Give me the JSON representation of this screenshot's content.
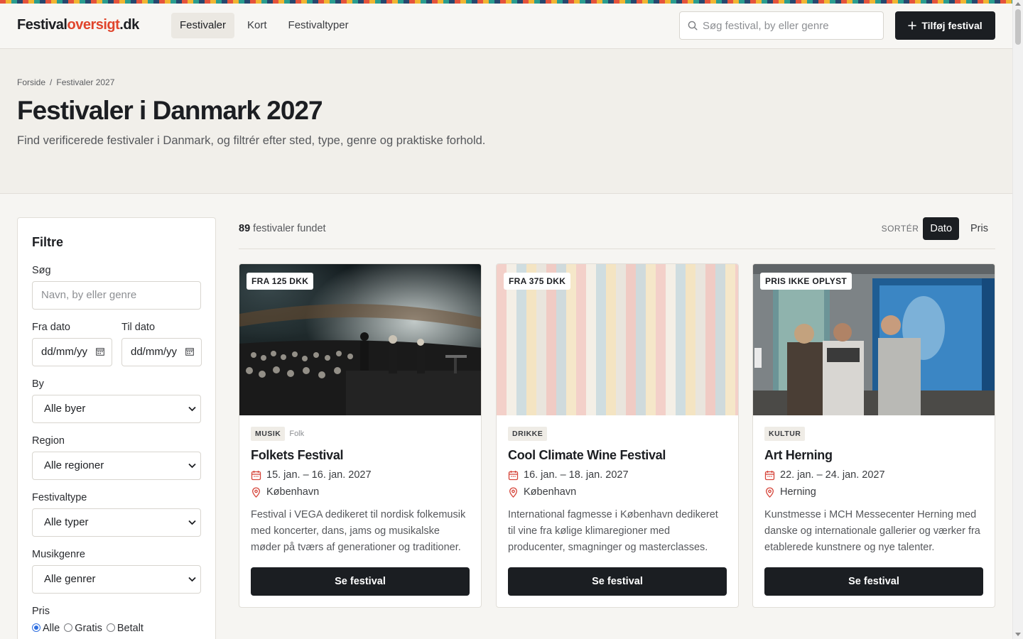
{
  "header": {
    "logo_part1": "Festival",
    "logo_part2": "oversigt",
    "logo_part3": ".dk",
    "nav": [
      "Festivaler",
      "Kort",
      "Festivaltyper"
    ],
    "search_placeholder": "Søg festival, by eller genre",
    "add_button": "Tilføj festival"
  },
  "hero": {
    "breadcrumb_home": "Forside",
    "breadcrumb_separator": "/",
    "breadcrumb_current": "Festivaler 2027",
    "title": "Festivaler i Danmark 2027",
    "description": "Find verificerede festivaler i Danmark, og filtrér efter sted, type, genre og praktiske forhold."
  },
  "filters": {
    "title": "Filtre",
    "search_label": "Søg",
    "search_placeholder": "Navn, by eller genre",
    "from_label": "Fra dato",
    "to_label": "Til dato",
    "date_placeholder": "dd/mm/yy",
    "city_label": "By",
    "city_value": "Alle byer",
    "region_label": "Region",
    "region_value": "Alle regioner",
    "type_label": "Festivaltype",
    "type_value": "Alle typer",
    "genre_label": "Musikgenre",
    "genre_value": "Alle genrer",
    "price_label": "Pris",
    "price_options": [
      "Alle",
      "Gratis",
      "Betalt"
    ],
    "price_selected": "Alle"
  },
  "results": {
    "count": "89",
    "count_label": "festivaler fundet",
    "sort_label": "SORTÉR",
    "sort_options": [
      "Dato",
      "Pris"
    ],
    "sort_selected": "Dato"
  },
  "cards": [
    {
      "badge": "FRA 125 DKK",
      "tag": "MUSIK",
      "subtag": "Folk",
      "title": "Folkets Festival",
      "dates": "15. jan. – 16. jan. 2027",
      "city": "København",
      "description": "Festival i VEGA dedikeret til nordisk folkemusik med koncerter, dans, jams og musikalske møder på tværs af generationer og traditioner.",
      "cta": "Se festival"
    },
    {
      "badge": "FRA 375 DKK",
      "tag": "DRIKKE",
      "subtag": "",
      "title": "Cool Climate Wine Festival",
      "dates": "16. jan. – 18. jan. 2027",
      "city": "København",
      "description": "International fagmesse i København dedikeret til vine fra kølige klimaregioner med producenter, smagninger og masterclasses.",
      "cta": "Se festival"
    },
    {
      "badge": "PRIS IKKE OPLYST",
      "tag": "KULTUR",
      "subtag": "",
      "title": "Art Herning",
      "dates": "22. jan. – 24. jan. 2027",
      "city": "Herning",
      "description": "Kunstmesse i MCH Messecenter Herning med danske og internationale gallerier og værker fra etablerede kunstnere og nye talenter.",
      "cta": "Se festival"
    }
  ],
  "colors": {
    "accent": "#e0452c",
    "dark": "#1b1e22",
    "icon_red": "#d6453a"
  }
}
